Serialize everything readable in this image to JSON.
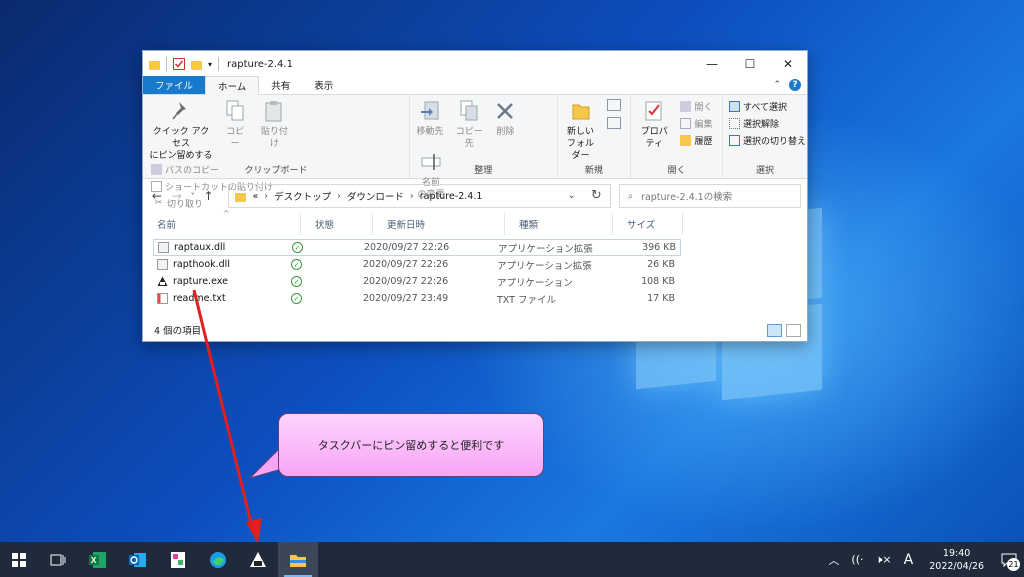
{
  "explorer": {
    "title": "rapture-2.4.1",
    "window_controls": {
      "minimize": "—",
      "maximize": "☐",
      "close": "✕"
    },
    "ribbon_tabs": [
      "ファイル",
      "ホーム",
      "共有",
      "表示"
    ],
    "ribbon": {
      "clipboard": {
        "label": "クリップボード",
        "quick_access": "クイック アクセス\nにピン留めする",
        "copy": "コピー",
        "paste": "貼り付け",
        "copy_path": "パスのコピー",
        "paste_shortcut": "ショートカットの貼り付け",
        "cut": "切り取り"
      },
      "organize": {
        "label": "整理",
        "move_to": "移動先",
        "copy_to": "コピー先",
        "delete": "削除",
        "rename": "名前\nの変更"
      },
      "new": {
        "label": "新規",
        "new_folder": "新しい\nフォルダー"
      },
      "open": {
        "label": "開く",
        "properties": "プロパティ",
        "open": "開く",
        "edit": "編集",
        "history": "履歴"
      },
      "select": {
        "label": "選択",
        "select_all": "すべて選択",
        "select_none": "選択解除",
        "invert": "選択の切り替え"
      }
    },
    "address": {
      "prefix": "«",
      "crumbs": [
        "デスクトップ",
        "ダウンロード",
        "rapture-2.4.1"
      ],
      "search_placeholder": "rapture-2.4.1の検索"
    },
    "columns": [
      "名前",
      "状態",
      "更新日時",
      "種類",
      "サイズ"
    ],
    "files": [
      {
        "name": "raptaux.dll",
        "date": "2020/09/27 22:26",
        "type": "アプリケーション拡張",
        "size": "396 KB"
      },
      {
        "name": "rapthook.dll",
        "date": "2020/09/27 22:26",
        "type": "アプリケーション拡張",
        "size": "26 KB"
      },
      {
        "name": "rapture.exe",
        "date": "2020/09/27 22:26",
        "type": "アプリケーション",
        "size": "108 KB"
      },
      {
        "name": "readme.txt",
        "date": "2020/09/27 23:49",
        "type": "TXT ファイル",
        "size": "17 KB"
      }
    ],
    "status": "4 個の項目"
  },
  "callout": {
    "text": "タスクバーにピン留めすると便利です"
  },
  "taskbar": {
    "icons": [
      "windows-start-icon",
      "task-view-icon",
      "excel-icon",
      "outlook-icon",
      "app-icon",
      "edge-icon",
      "rapture-icon",
      "file-explorer-icon"
    ],
    "tray": {
      "ime": "A",
      "time": "19:40",
      "date": "2022/04/26",
      "notification_count": "21"
    }
  },
  "colors": {
    "accent": "#1979ca",
    "callout": "#f6a6f5",
    "arrow": "#e0201e",
    "taskbar": "#1f2a3a"
  }
}
